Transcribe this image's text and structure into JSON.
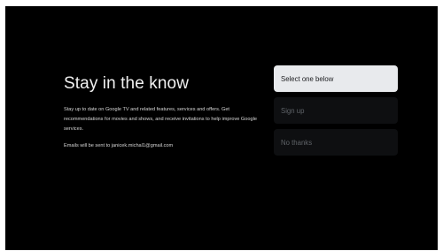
{
  "main": {
    "title": "Stay in the know",
    "description": "Stay up to date on Google TV and related features, services and offers. Get recommendations for movies and shows, and receive invitations to help improve Google services.",
    "email_note": "Emails will be sent to janicek.michal1@gmail.com"
  },
  "options": [
    {
      "label": "Select one below",
      "state": "focused"
    },
    {
      "label": "Sign up",
      "state": "unfocused"
    },
    {
      "label": "No thanks",
      "state": "unfocused"
    }
  ],
  "colors": {
    "background": "#000000",
    "focused_option_bg": "#e8eaed",
    "unfocused_option_bg": "#0e0f11",
    "unfocused_option_text": "#5f6368"
  }
}
